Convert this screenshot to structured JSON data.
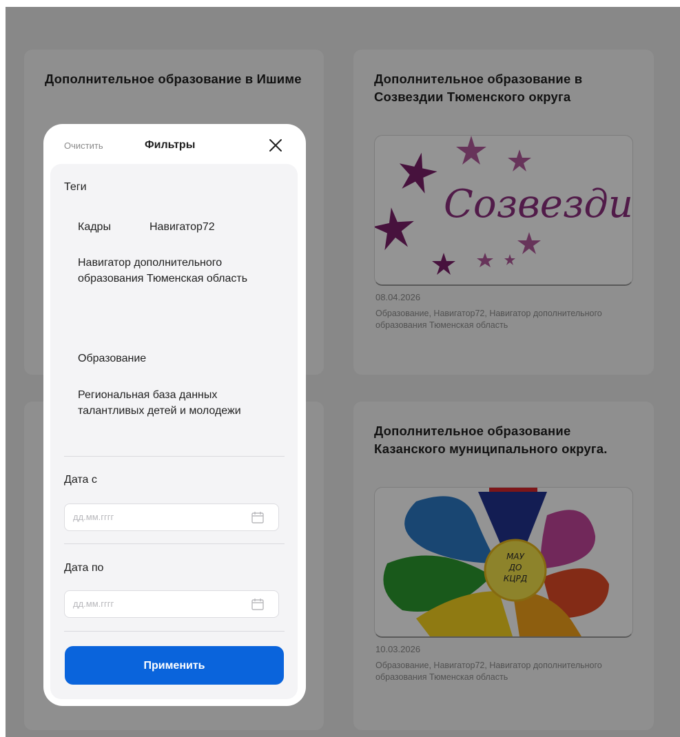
{
  "cards": [
    {
      "title": "Дополнительное образование в Ишиме",
      "date": "",
      "tags": ""
    },
    {
      "title": "Дополнительное образование в Созвездии Тюменского округа",
      "date": "08.04.2026",
      "tags": "Образование, Навигатор72, Навигатор дополнительного образования Тюменская область",
      "image_text": "Созвездие"
    },
    {
      "title": "",
      "date": "",
      "tags": ""
    },
    {
      "title": "Дополнительное образование Казанского муниципального округа.",
      "date": "10.03.2026",
      "tags": "Образование, Навигатор72, Навигатор дополнительного образования Тюменская область",
      "image_text": [
        "МАУ",
        "ДО",
        "КЦРД"
      ]
    }
  ],
  "filter": {
    "clear_label": "Очистить",
    "title": "Фильтры",
    "tags_label": "Теги",
    "tags": [
      "Кадры",
      "Навигатор72",
      "Навигатор дополнительного образования Тюменская область",
      "Образование",
      "Региональная база данных талантливых детей и молодежи"
    ],
    "date_from_label": "Дата с",
    "date_to_label": "Дата по",
    "date_placeholder": "дд.мм.гггг",
    "apply_label": "Применить"
  },
  "colors": {
    "apply_button": "#0a64dc",
    "overlay": "rgba(0,0,0,0.42)",
    "star": "#7a1f6a"
  },
  "icons": [
    "close-icon",
    "calendar-icon"
  ]
}
